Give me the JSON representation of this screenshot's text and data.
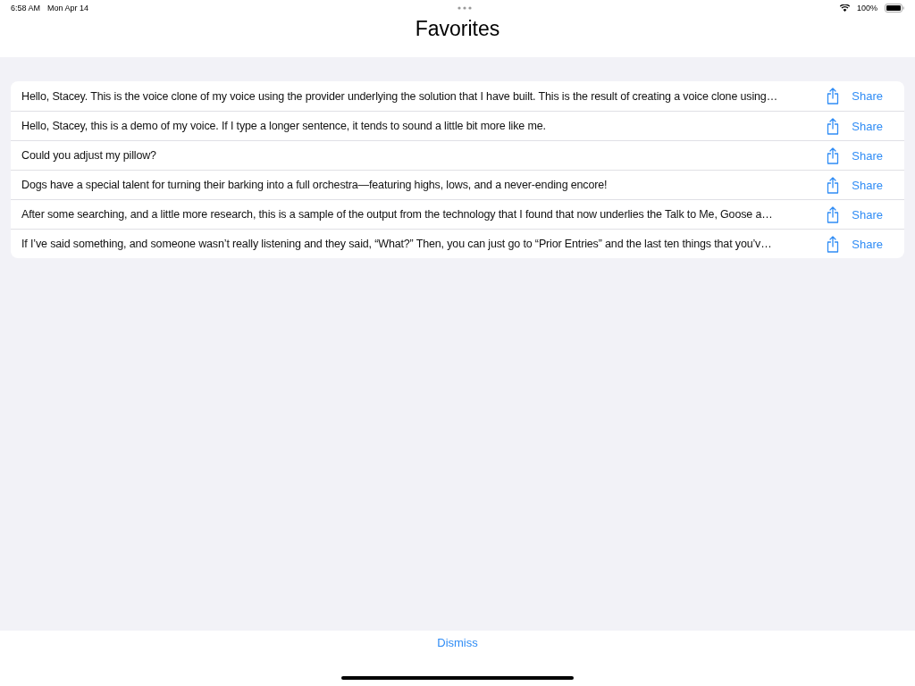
{
  "status_bar": {
    "time": "6:58 AM",
    "date": "Mon Apr 14",
    "battery": "100%"
  },
  "title": "Favorites",
  "favorites": [
    {
      "text": "Hello, Stacey. This is the voice clone of my voice using the provider underlying the solution that I have built. This is the result of creating a voice clone using…",
      "share": "Share"
    },
    {
      "text": "Hello, Stacey, this is a demo of my voice. If I type a longer sentence, it tends to sound a little bit more like me.",
      "share": "Share"
    },
    {
      "text": "Could you adjust my pillow?",
      "share": "Share"
    },
    {
      "text": "Dogs have a special talent for turning their barking into a full orchestra—featuring highs, lows, and a never-ending encore!",
      "share": "Share"
    },
    {
      "text": "After some searching, and a little more research, this is a sample of the output from the technology that I found that now underlies the Talk to Me, Goose a…",
      "share": "Share"
    },
    {
      "text": "If I’ve said something, and someone wasn’t really listening and they said, “What?” Then, you can just go to “Prior Entries” and the last ten things that you’v…",
      "share": "Share"
    }
  ],
  "dismiss": "Dismiss"
}
